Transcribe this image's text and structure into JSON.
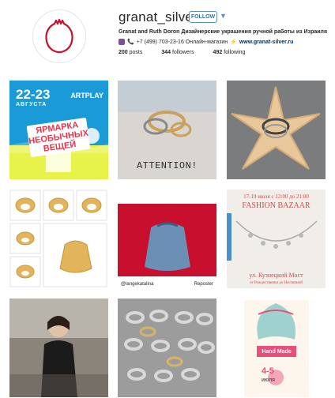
{
  "profile": {
    "username": "granat_silver",
    "follow_label": "FOLLOW",
    "bio_line1": "Granat and Ruth Doron Дизайнерские украшения ручной работы из Израиля",
    "bio_line2_text": "+7 (499) 703-23-16 Онлайн-магазин",
    "website": "www.granat-silver.ru",
    "stats": {
      "posts": "200",
      "posts_label": "posts",
      "followers": "344",
      "followers_label": "followers",
      "following": "492",
      "following_label": "following"
    }
  },
  "colors": {
    "accent": "#3f729b",
    "follow_border": "#5b8fc7",
    "pomegranate": "#c8102e",
    "poster_blue": "#1a9ad6"
  },
  "posts": [
    {
      "date": "22-23",
      "month": "АВГУСТА",
      "brand": "ARTPLAY",
      "title": "ЯРМАРКА НЕОБЫЧНЫХ ВЕЩЕЙ"
    },
    {
      "caption": "ATTENTION!"
    },
    {},
    {},
    {
      "repost_user": "@langekatalina",
      "repost_label": "Reposter"
    },
    {
      "line1": "17-19 июля с 12:00 до 21:00",
      "line2": "FASHION BAZAAR",
      "line3": "ул. Кузнецкий Мост",
      "line4": "от Рождественки до Неглинной"
    },
    {},
    {},
    {
      "banner": "Hand Made",
      "dates": "4-5",
      "month": "июля"
    }
  ]
}
